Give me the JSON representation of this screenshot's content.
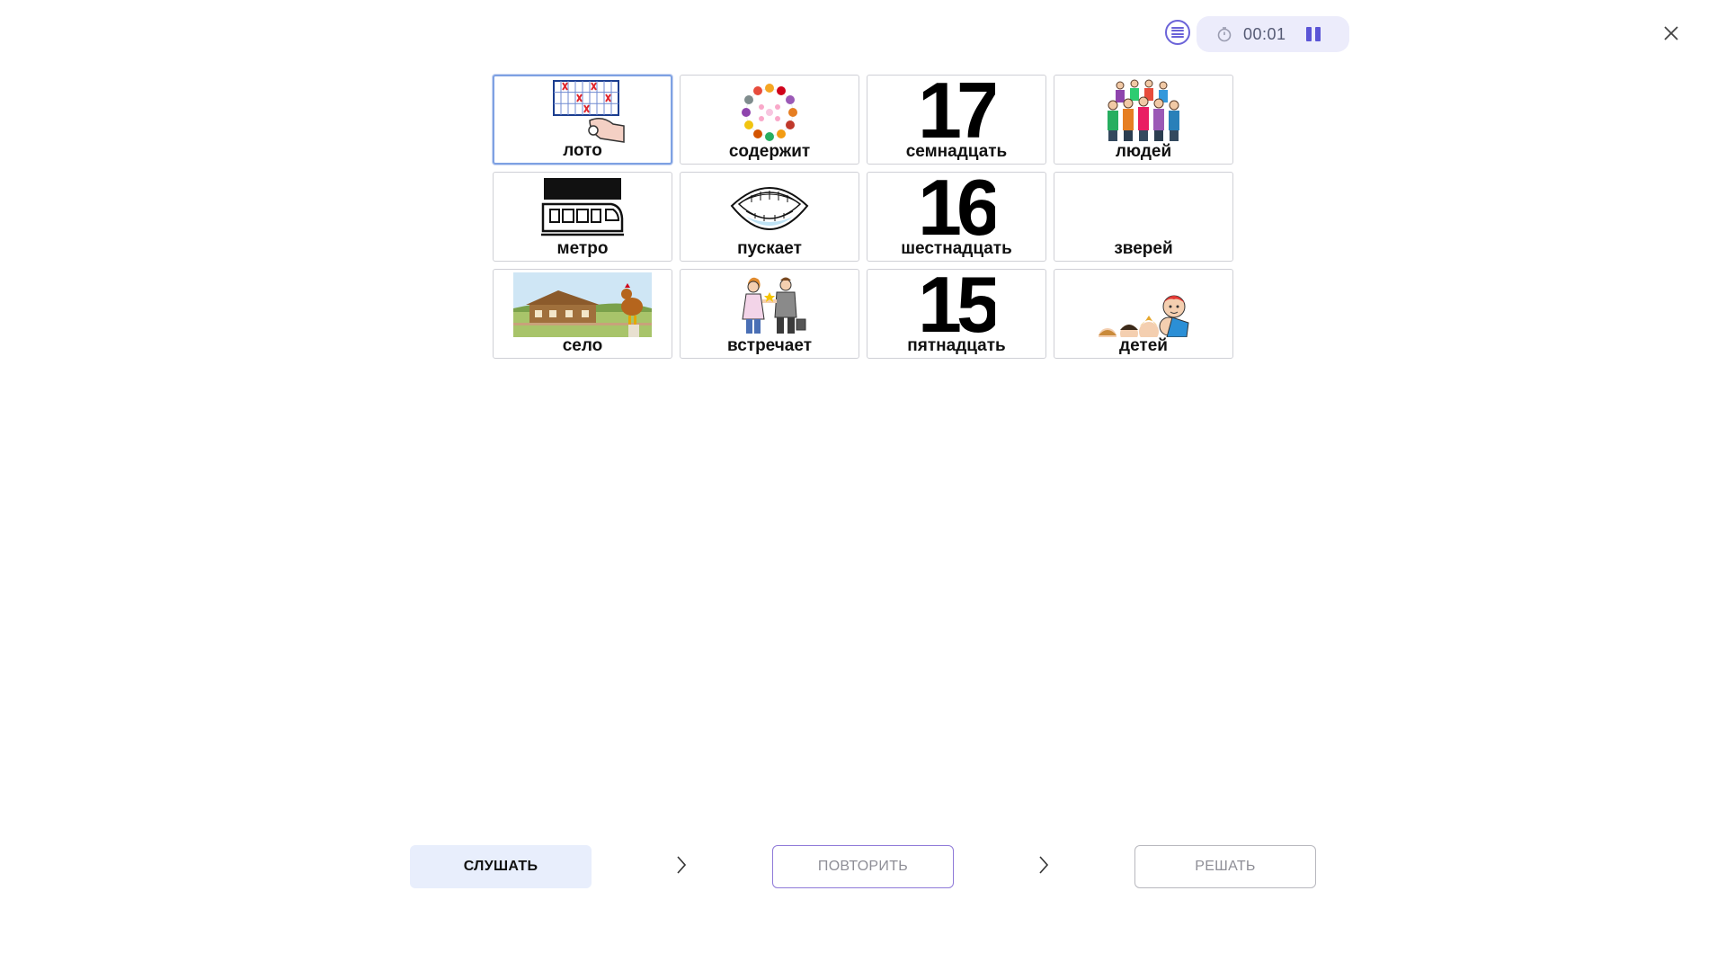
{
  "header": {
    "menu_icon": "list-icon",
    "timer": {
      "icon": "stopwatch-icon",
      "time": "00:01",
      "pause_icon": "pause-icon"
    },
    "close_icon": "close-icon"
  },
  "cards": [
    {
      "label": "лото",
      "icon": "lotto-card-image",
      "selected": true
    },
    {
      "label": "содержит",
      "icon": "fruit-circle-image"
    },
    {
      "label": "семнадцать",
      "icon": "number-image",
      "number": "17"
    },
    {
      "label": "людей",
      "icon": "people-group-image"
    },
    {
      "label": "метро",
      "icon": "metro-train-image"
    },
    {
      "label": "пускает",
      "icon": "open-mouth-image"
    },
    {
      "label": "шестнадцать",
      "icon": "number-image",
      "number": "16"
    },
    {
      "label": "зверей",
      "icon": "blank-image"
    },
    {
      "label": "село",
      "icon": "village-image"
    },
    {
      "label": "встречает",
      "icon": "meeting-people-image"
    },
    {
      "label": "пятнадцать",
      "icon": "number-image",
      "number": "15"
    },
    {
      "label": "детей",
      "icon": "children-image"
    }
  ],
  "footer": {
    "listen_label": "СЛУШАТЬ",
    "repeat_label": "ПОВТОРИТЬ",
    "solve_label": "РЕШАТЬ",
    "arrow_icon": "chevron-right-icon"
  },
  "colors": {
    "accent": "#5b55d6",
    "listen_bg": "#e8eefc",
    "selected_border": "#7ea1e3"
  }
}
